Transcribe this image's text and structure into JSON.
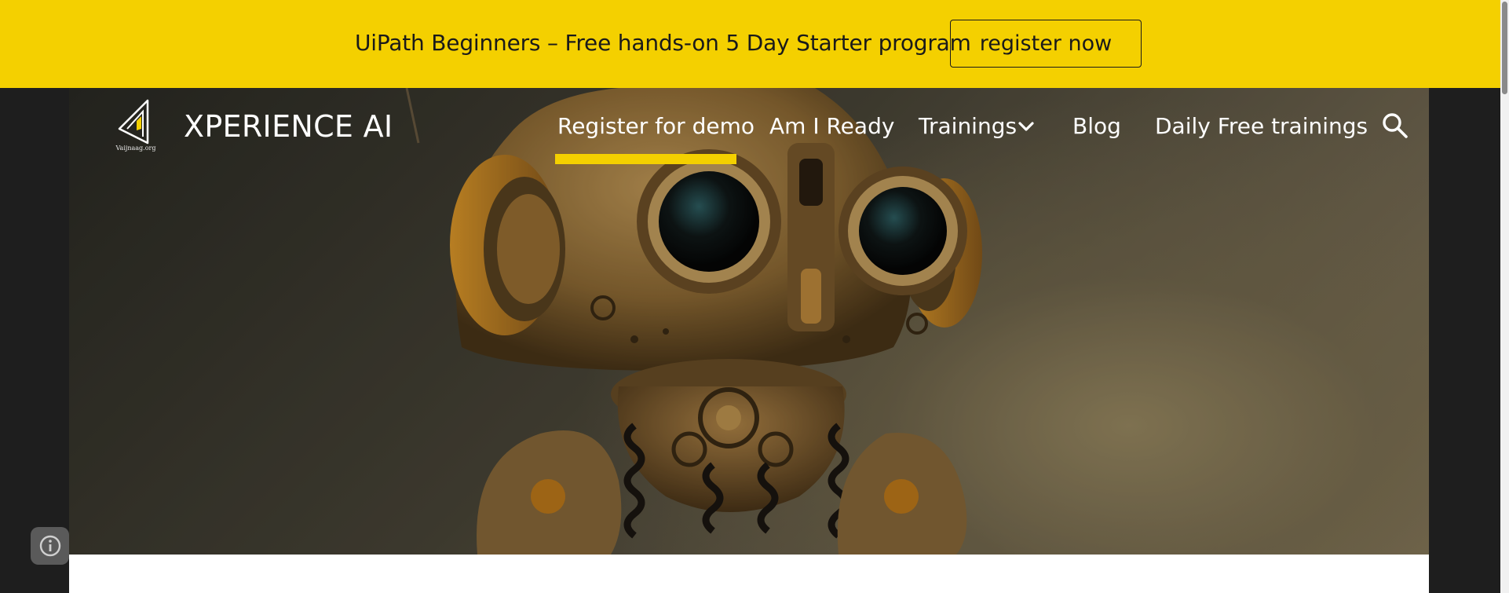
{
  "banner": {
    "text": "UiPath Beginners – Free hands-on 5 Day Starter program",
    "button_label": "register now",
    "background_color": "#f4d000"
  },
  "header": {
    "logo_icon": "xperience-ai-logo-icon",
    "logo_caption": "Vaijnaag.org",
    "site_title": "XPERIENCE AI",
    "nav": {
      "register_demo": "Register for demo",
      "am_i_ready": "Am I Ready",
      "trainings": "Trainings",
      "blog": "Blog",
      "daily_free": "Daily Free trainings"
    },
    "active_nav": "Register for demo",
    "accent_color": "#f4d000",
    "search_icon": "search-icon",
    "dropdown_icon": "chevron-down-icon"
  },
  "hero": {
    "image": "robot-illustration"
  },
  "info_button": {
    "icon": "info-icon"
  }
}
